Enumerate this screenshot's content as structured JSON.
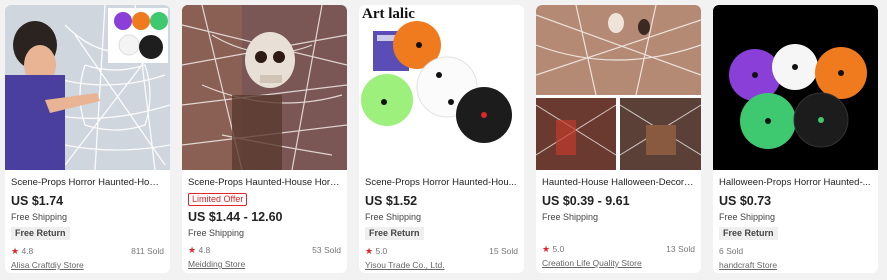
{
  "products": [
    {
      "title": "Scene-Props Horror Haunted-House...",
      "price": "US $1.74",
      "shipping": "Free Shipping",
      "return": "Free Return",
      "rating": "4.8",
      "sold": "811 Sold",
      "store": "Alisa Craftdiy Store"
    },
    {
      "title": "Scene-Props Haunted-House Horro...",
      "badge": "Limited Offer",
      "price": "US $1.44 - 12.60",
      "shipping": "Free Shipping",
      "rating": "4.8",
      "sold": "53 Sold",
      "store": "Meidding Store"
    },
    {
      "image_caption": "Art lalic",
      "title": "Scene-Props Horror Haunted-Hou...",
      "price": "US $1.52",
      "shipping": "Free Shipping",
      "return": "Free Return",
      "rating": "5.0",
      "sold": "15 Sold",
      "store": "Yisou Trade Co., Ltd."
    },
    {
      "title": "Haunted-House Halloween-Decora...",
      "price": "US $0.39 - 9.61",
      "shipping": "Free Shipping",
      "rating": "5.0",
      "sold": "13 Sold",
      "store": "Creation Life Quality Store"
    },
    {
      "title": "Halloween-Props Horror Haunted-...",
      "price": "US $0.73",
      "shipping": "Free Shipping",
      "return": "Free Return",
      "sold": "6 Sold",
      "store": "handcraft Store"
    }
  ],
  "colors": {
    "accent": "#e0262c",
    "orange": "#f07a1e",
    "purple": "#8a3fd8",
    "green": "#3ec870"
  }
}
